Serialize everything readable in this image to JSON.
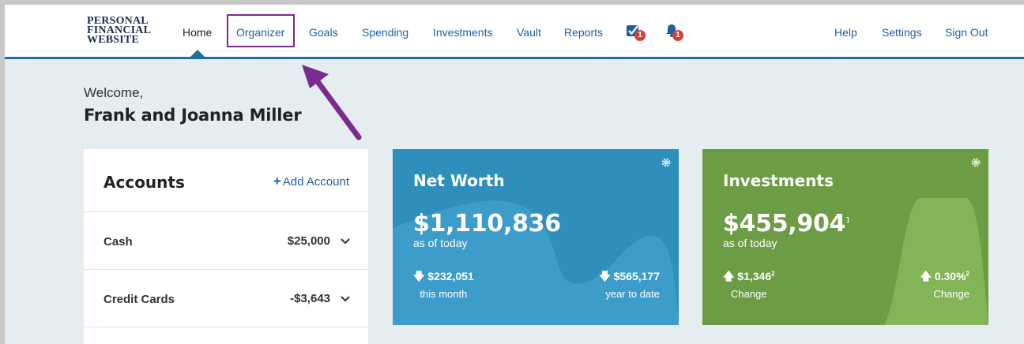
{
  "logo": {
    "line1": "PERSONAL",
    "line2": "FINANCIAL",
    "line3": "WEBSITE"
  },
  "nav": {
    "items": [
      "Home",
      "Organizer",
      "Goals",
      "Spending",
      "Investments",
      "Vault",
      "Reports"
    ],
    "tasks_badge": "1",
    "alerts_badge": "1",
    "right": [
      "Help",
      "Settings",
      "Sign Out"
    ]
  },
  "welcome": {
    "greeting": "Welcome,",
    "name": "Frank and Joanna Miller"
  },
  "accounts": {
    "title": "Accounts",
    "add_label": "Add Account",
    "rows": [
      {
        "label": "Cash",
        "amount": "$25,000"
      },
      {
        "label": "Credit Cards",
        "amount": "-$3,643"
      }
    ]
  },
  "net_worth": {
    "title": "Net Worth",
    "value": "$1,110,836",
    "as_of": "as of today",
    "stat1_value": "$232,051",
    "stat1_label": "this month",
    "stat2_value": "$565,177",
    "stat2_label": "year to date"
  },
  "investments": {
    "title": "Investments",
    "value": "$455,904",
    "value_note": "1",
    "as_of": "as of today",
    "stat1_value": "$1,346",
    "stat1_note": "2",
    "stat1_label": "Change",
    "stat2_value": "0.30%",
    "stat2_note": "2",
    "stat2_label": "Change"
  },
  "colors": {
    "nav_link": "#1f5fa3",
    "highlight": "#7b2a8e",
    "net_worth_bg": "#2e8fbd",
    "investments_bg": "#6c9c43",
    "badge": "#d64036"
  }
}
